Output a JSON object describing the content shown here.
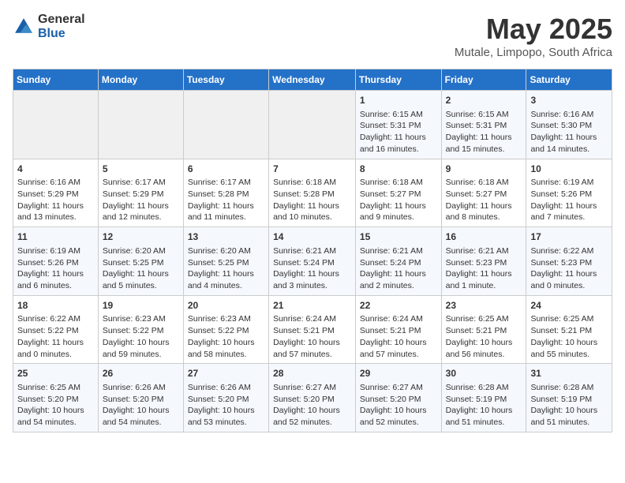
{
  "logo": {
    "general": "General",
    "blue": "Blue"
  },
  "header": {
    "month": "May 2025",
    "location": "Mutale, Limpopo, South Africa"
  },
  "days_of_week": [
    "Sunday",
    "Monday",
    "Tuesday",
    "Wednesday",
    "Thursday",
    "Friday",
    "Saturday"
  ],
  "weeks": [
    [
      {
        "day": "",
        "info": ""
      },
      {
        "day": "",
        "info": ""
      },
      {
        "day": "",
        "info": ""
      },
      {
        "day": "",
        "info": ""
      },
      {
        "day": "1",
        "info": "Sunrise: 6:15 AM\nSunset: 5:31 PM\nDaylight: 11 hours and 16 minutes."
      },
      {
        "day": "2",
        "info": "Sunrise: 6:15 AM\nSunset: 5:31 PM\nDaylight: 11 hours and 15 minutes."
      },
      {
        "day": "3",
        "info": "Sunrise: 6:16 AM\nSunset: 5:30 PM\nDaylight: 11 hours and 14 minutes."
      }
    ],
    [
      {
        "day": "4",
        "info": "Sunrise: 6:16 AM\nSunset: 5:29 PM\nDaylight: 11 hours and 13 minutes."
      },
      {
        "day": "5",
        "info": "Sunrise: 6:17 AM\nSunset: 5:29 PM\nDaylight: 11 hours and 12 minutes."
      },
      {
        "day": "6",
        "info": "Sunrise: 6:17 AM\nSunset: 5:28 PM\nDaylight: 11 hours and 11 minutes."
      },
      {
        "day": "7",
        "info": "Sunrise: 6:18 AM\nSunset: 5:28 PM\nDaylight: 11 hours and 10 minutes."
      },
      {
        "day": "8",
        "info": "Sunrise: 6:18 AM\nSunset: 5:27 PM\nDaylight: 11 hours and 9 minutes."
      },
      {
        "day": "9",
        "info": "Sunrise: 6:18 AM\nSunset: 5:27 PM\nDaylight: 11 hours and 8 minutes."
      },
      {
        "day": "10",
        "info": "Sunrise: 6:19 AM\nSunset: 5:26 PM\nDaylight: 11 hours and 7 minutes."
      }
    ],
    [
      {
        "day": "11",
        "info": "Sunrise: 6:19 AM\nSunset: 5:26 PM\nDaylight: 11 hours and 6 minutes."
      },
      {
        "day": "12",
        "info": "Sunrise: 6:20 AM\nSunset: 5:25 PM\nDaylight: 11 hours and 5 minutes."
      },
      {
        "day": "13",
        "info": "Sunrise: 6:20 AM\nSunset: 5:25 PM\nDaylight: 11 hours and 4 minutes."
      },
      {
        "day": "14",
        "info": "Sunrise: 6:21 AM\nSunset: 5:24 PM\nDaylight: 11 hours and 3 minutes."
      },
      {
        "day": "15",
        "info": "Sunrise: 6:21 AM\nSunset: 5:24 PM\nDaylight: 11 hours and 2 minutes."
      },
      {
        "day": "16",
        "info": "Sunrise: 6:21 AM\nSunset: 5:23 PM\nDaylight: 11 hours and 1 minute."
      },
      {
        "day": "17",
        "info": "Sunrise: 6:22 AM\nSunset: 5:23 PM\nDaylight: 11 hours and 0 minutes."
      }
    ],
    [
      {
        "day": "18",
        "info": "Sunrise: 6:22 AM\nSunset: 5:22 PM\nDaylight: 11 hours and 0 minutes."
      },
      {
        "day": "19",
        "info": "Sunrise: 6:23 AM\nSunset: 5:22 PM\nDaylight: 10 hours and 59 minutes."
      },
      {
        "day": "20",
        "info": "Sunrise: 6:23 AM\nSunset: 5:22 PM\nDaylight: 10 hours and 58 minutes."
      },
      {
        "day": "21",
        "info": "Sunrise: 6:24 AM\nSunset: 5:21 PM\nDaylight: 10 hours and 57 minutes."
      },
      {
        "day": "22",
        "info": "Sunrise: 6:24 AM\nSunset: 5:21 PM\nDaylight: 10 hours and 57 minutes."
      },
      {
        "day": "23",
        "info": "Sunrise: 6:25 AM\nSunset: 5:21 PM\nDaylight: 10 hours and 56 minutes."
      },
      {
        "day": "24",
        "info": "Sunrise: 6:25 AM\nSunset: 5:21 PM\nDaylight: 10 hours and 55 minutes."
      }
    ],
    [
      {
        "day": "25",
        "info": "Sunrise: 6:25 AM\nSunset: 5:20 PM\nDaylight: 10 hours and 54 minutes."
      },
      {
        "day": "26",
        "info": "Sunrise: 6:26 AM\nSunset: 5:20 PM\nDaylight: 10 hours and 54 minutes."
      },
      {
        "day": "27",
        "info": "Sunrise: 6:26 AM\nSunset: 5:20 PM\nDaylight: 10 hours and 53 minutes."
      },
      {
        "day": "28",
        "info": "Sunrise: 6:27 AM\nSunset: 5:20 PM\nDaylight: 10 hours and 52 minutes."
      },
      {
        "day": "29",
        "info": "Sunrise: 6:27 AM\nSunset: 5:20 PM\nDaylight: 10 hours and 52 minutes."
      },
      {
        "day": "30",
        "info": "Sunrise: 6:28 AM\nSunset: 5:19 PM\nDaylight: 10 hours and 51 minutes."
      },
      {
        "day": "31",
        "info": "Sunrise: 6:28 AM\nSunset: 5:19 PM\nDaylight: 10 hours and 51 minutes."
      }
    ]
  ]
}
